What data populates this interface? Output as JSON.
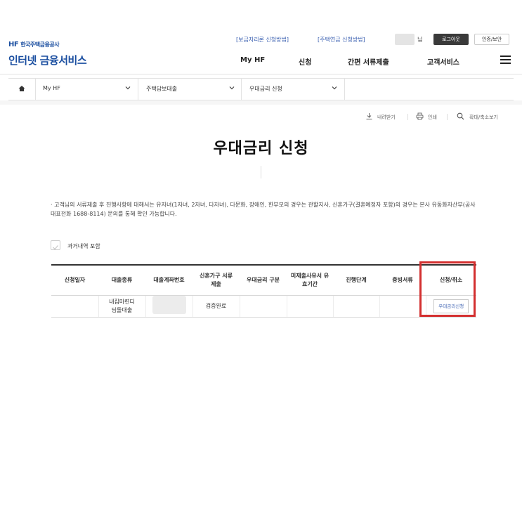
{
  "header": {
    "logo_mark": "HF",
    "logo_org": "한국주택금융공사",
    "service_title": "인터넷 금융서비스",
    "top_links": [
      "[보금자리론 신청방법]",
      "[주택연금 신청방법]"
    ],
    "user_suffix": "님",
    "logout_label": "로그아웃",
    "cert_label": "인증/보안",
    "gnb": [
      "My HF",
      "신청",
      "간편 서류제출",
      "고객서비스"
    ]
  },
  "breadcrumb": {
    "items": [
      "My HF",
      "주택담보대출",
      "우대금리 신청"
    ]
  },
  "utility": {
    "download": "내려받기",
    "print": "인쇄",
    "zoom": "확대/축소보기"
  },
  "page": {
    "title": "우대금리 신청",
    "notice": "· 고객님의 서류제출 후 진행사항에 대해서는 유자녀(1자녀, 2자녀, 다자녀), 다문화, 장애인, 한부모의 경우는 관할지사, 신혼가구(결혼예정자 포함)의 경우는 본사 유동화자산부(공사 대표전화 1688-8114) 문의를 통해 확인 가능합니다.",
    "include_history_label": "과거내역 포함"
  },
  "table": {
    "headers": [
      "신청일자",
      "대출종류",
      "대출계좌번호",
      "신혼가구 서류제출",
      "우대금리 구분",
      "미제출사유서 유효기간",
      "진행단계",
      "증빙서류",
      "신청/취소"
    ],
    "row": {
      "apply_date": "",
      "loan_type": "내집마련디딤돌대출",
      "account_masked": true,
      "newlywed_docs": "검증완료",
      "rate_type": "",
      "reason_validity": "",
      "stage": "",
      "evidence": "",
      "action_label": "우대금리신청"
    }
  },
  "colors": {
    "brand_blue": "#1a4ea0",
    "link_blue": "#3a5fb0",
    "highlight_red": "#d32f2f"
  }
}
